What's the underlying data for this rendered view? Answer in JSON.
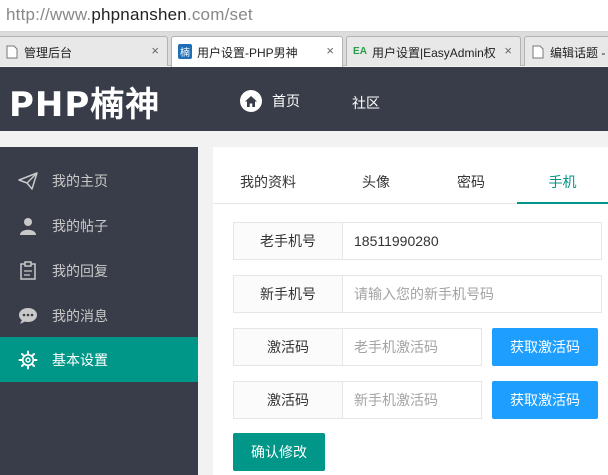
{
  "browser": {
    "address_prefix": "http://www.",
    "address_host": "phpnanshen",
    "address_suffix": ".com/set",
    "tabs": [
      {
        "title": "管理后台",
        "icon": "page-icon"
      },
      {
        "title": "用户设置-PHP男神",
        "icon": "site-favicon-icon",
        "favicon_char": "楠"
      },
      {
        "title": "用户设置|EasyAdmin权",
        "icon": "easyadmin-favicon-icon",
        "favicon_char": "EA"
      },
      {
        "title": "编辑话题 -",
        "icon": "page-icon"
      }
    ],
    "close_glyph": "×"
  },
  "header": {
    "logo": "PHP楠神",
    "nav": [
      {
        "label": "首页",
        "icon": "home-icon"
      },
      {
        "label": "社区"
      }
    ]
  },
  "sidebar": {
    "items": [
      {
        "label": "我的主页",
        "icon": "paper-plane-icon"
      },
      {
        "label": "我的帖子",
        "icon": "user-icon"
      },
      {
        "label": "我的回复",
        "icon": "clipboard-icon"
      },
      {
        "label": "我的消息",
        "icon": "chat-bubble-icon"
      },
      {
        "label": "基本设置",
        "icon": "gear-icon",
        "active": true
      }
    ]
  },
  "main": {
    "tabs": [
      {
        "label": "我的资料"
      },
      {
        "label": "头像"
      },
      {
        "label": "密码"
      },
      {
        "label": "手机",
        "active": true
      }
    ],
    "form": {
      "old_phone_label": "老手机号",
      "old_phone_value": "18511990280",
      "new_phone_label": "新手机号",
      "new_phone_placeholder": "请输入您的新手机号码",
      "code1_label": "激活码",
      "code1_placeholder": "老手机激活码",
      "code1_button": "获取激活码",
      "code2_label": "激活码",
      "code2_placeholder": "新手机激活码",
      "code2_button": "获取激活码",
      "submit_label": "确认修改"
    }
  },
  "colors": {
    "header_bg": "#393d49",
    "accent": "#009688",
    "button_blue": "#1e9fff"
  }
}
